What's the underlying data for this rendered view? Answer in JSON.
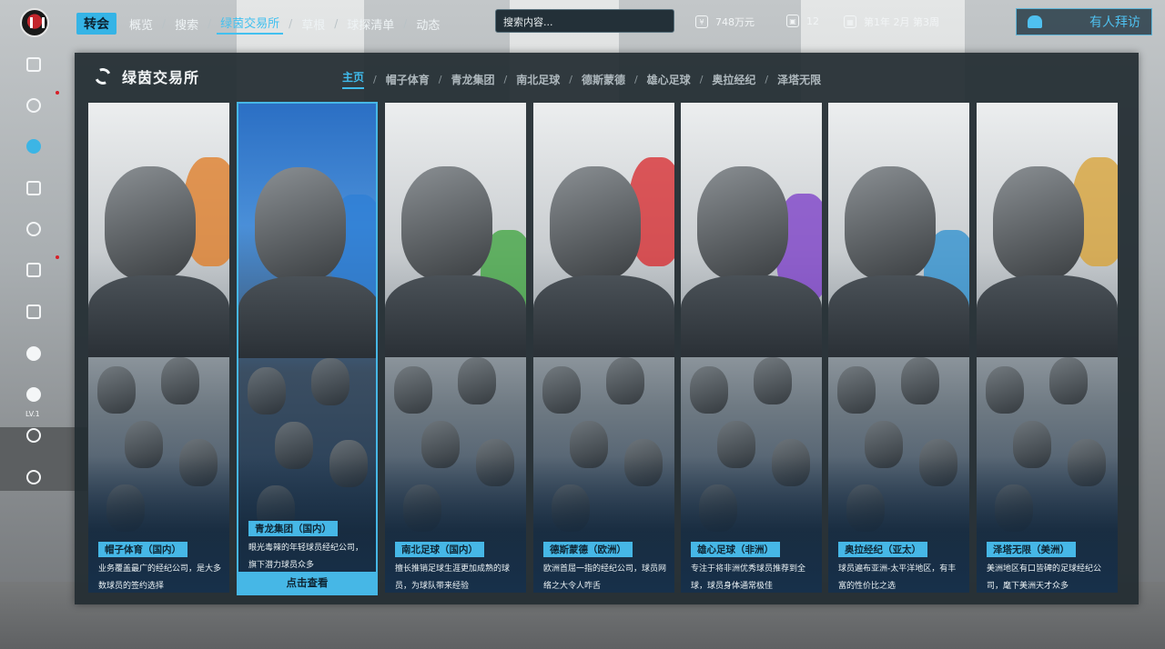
{
  "topbar": {
    "primary_tab": "转会",
    "nav": [
      "概览",
      "搜索",
      "绿茵交易所",
      "草根",
      "球探清单",
      "动态"
    ],
    "active_nav": "绿茵交易所",
    "search_placeholder": "搜索内容...",
    "money": "748万元",
    "count": "12",
    "date": "第1年 2月 第3周",
    "visitor_button": "有人拜访"
  },
  "sidebar": {
    "items": [
      "home-icon",
      "training-icon",
      "transfer-icon",
      "academy-icon",
      "scout-icon",
      "gift-icon",
      "calendar-icon",
      "profile-icon",
      "info-icon",
      "settings-icon",
      "exit-icon"
    ],
    "level": "LV.1",
    "active": "transfer-icon"
  },
  "panel": {
    "title": "绿茵交易所",
    "subtabs": [
      "主页",
      "帽子体育",
      "青龙集团",
      "南北足球",
      "德斯蒙德",
      "雄心足球",
      "奥拉经纪",
      "泽塔无限"
    ],
    "active_subtab": "主页"
  },
  "cards": [
    {
      "name": "帽子体育（国内）",
      "desc": "业务覆盖最广的经纪公司，是大多数球员的签约选择",
      "accent": "#e07a20"
    },
    {
      "name": "青龙集团（国内）",
      "desc": "眼光毒辣的年轻球员经纪公司，旗下潜力球员众多",
      "accent": "#2e7fd6",
      "cta": "点击查看"
    },
    {
      "name": "南北足球（国内）",
      "desc": "擅长推销足球生涯更加成熟的球员，为球队带来经验",
      "accent": "#3ca43c"
    },
    {
      "name": "德斯蒙德（欧洲）",
      "desc": "欧洲首屈一指的经纪公司，球员网络之大令人咋舌",
      "accent": "#d8262a"
    },
    {
      "name": "雄心足球（非洲）",
      "desc": "专注于将非洲优秀球员推荐到全球，球员身体通常极佳",
      "accent": "#7a3ac8"
    },
    {
      "name": "奥拉经纪（亚太）",
      "desc": "球员遍布亚洲-太平洋地区，有丰富的性价比之选",
      "accent": "#2a8fd0"
    },
    {
      "name": "泽塔无限（美洲）",
      "desc": "美洲地区有口皆碑的足球经纪公司，麾下美洲天才众多",
      "accent": "#d8a030"
    }
  ]
}
